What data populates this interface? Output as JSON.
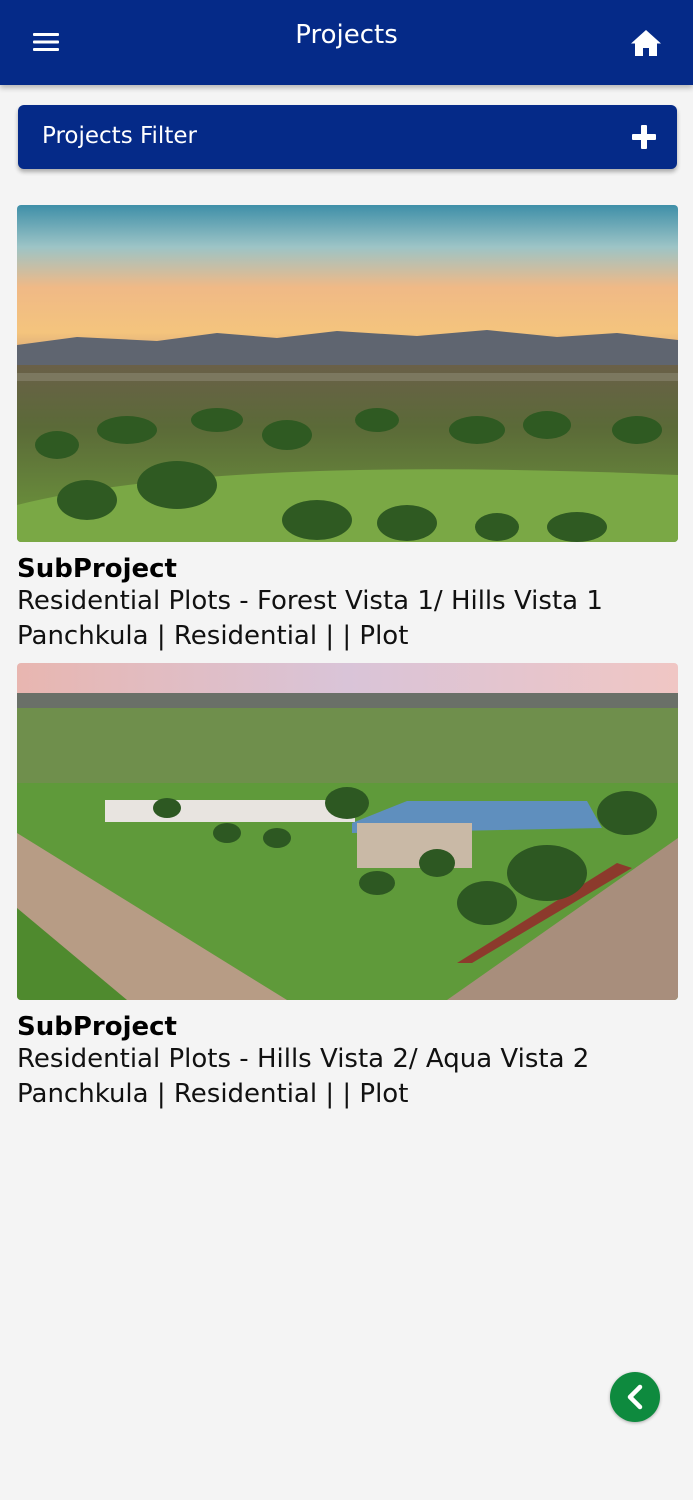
{
  "appbar": {
    "title": "Projects",
    "menu_icon": "hamburger-menu-icon",
    "home_icon": "home-icon",
    "background": "#052a88"
  },
  "filter": {
    "label": "Projects Filter",
    "icon": "plus-icon"
  },
  "projects": [
    {
      "kind": "SubProject",
      "name": "Residential Plots - Forest Vista 1/ Hills Vista 1",
      "meta": "Panchkula | Residential |  | Plot",
      "image": "sunset-landscape-photo"
    },
    {
      "kind": "SubProject",
      "name": "Residential Plots - Hills Vista 2/ Aqua Vista 2",
      "meta": "Panchkula | Residential |  | Plot",
      "image": "aerial-plot-site-photo"
    }
  ],
  "fab": {
    "icon": "chevron-left-icon",
    "color": "#0e8a3e"
  }
}
